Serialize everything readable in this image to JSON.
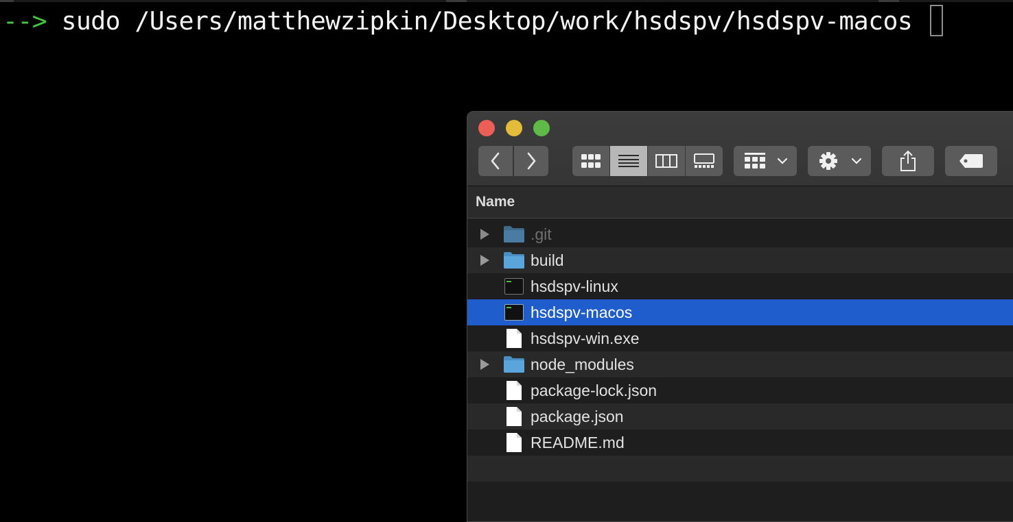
{
  "terminal": {
    "prompt": "-->",
    "command": "sudo /Users/matthewzipkin/Desktop/work/hsdspv/hsdspv-macos"
  },
  "finder": {
    "window_controls": [
      "close",
      "minimize",
      "zoom"
    ],
    "toolbar": {
      "back_icon": "chevron-left-icon",
      "forward_icon": "chevron-right-icon",
      "views": [
        "icon-view",
        "list-view",
        "column-view",
        "gallery-view"
      ],
      "active_view": "list-view",
      "group_icon": "group-by-icon",
      "action_icon": "gear-icon",
      "share_icon": "share-icon",
      "tag_icon": "tag-icon"
    },
    "list_header": {
      "name": "Name"
    },
    "items": [
      {
        "name": ".git",
        "type": "folder",
        "expandable": true,
        "dimmed": true
      },
      {
        "name": "build",
        "type": "folder",
        "expandable": true
      },
      {
        "name": "hsdspv-linux",
        "type": "executable"
      },
      {
        "name": "hsdspv-macos",
        "type": "executable",
        "selected": true
      },
      {
        "name": "hsdspv-win.exe",
        "type": "document"
      },
      {
        "name": "node_modules",
        "type": "folder",
        "expandable": true
      },
      {
        "name": "package-lock.json",
        "type": "document"
      },
      {
        "name": "package.json",
        "type": "document"
      },
      {
        "name": "README.md",
        "type": "document"
      }
    ]
  },
  "colors": {
    "prompt": "#45c43d",
    "selection": "#1f5ccc",
    "folder": "#5aa6dc"
  }
}
